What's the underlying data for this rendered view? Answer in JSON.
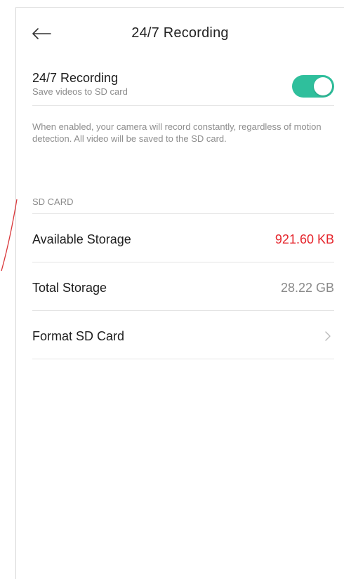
{
  "header": {
    "title": "24/7 Recording",
    "back_icon": "arrow-left-icon"
  },
  "recording_toggle": {
    "title": "24/7 Recording",
    "subtitle": "Save videos to SD card",
    "enabled": true,
    "on_color": "#2fbf9c"
  },
  "description": "When enabled, your camera will record constantly, regardless of motion detection. All video will be saved to the SD card.",
  "sd_card": {
    "section_title": "SD CARD",
    "rows": [
      {
        "label": "Available Storage",
        "value": "921.60 KB",
        "value_color": "#e5242b"
      },
      {
        "label": "Total Storage",
        "value": "28.22 GB"
      },
      {
        "label": "Format SD Card",
        "icon": "chevron-right-icon"
      }
    ]
  }
}
